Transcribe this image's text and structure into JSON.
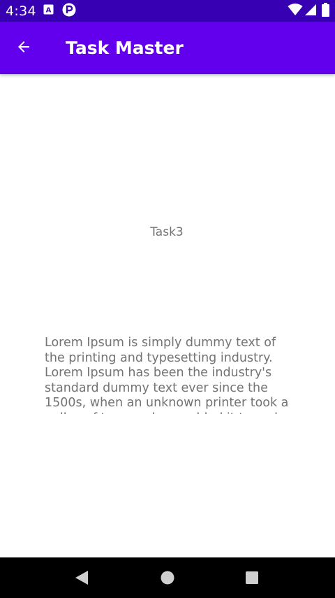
{
  "status_bar": {
    "time": "4:34",
    "background": "#3700b3",
    "icons": [
      "a-notification-icon",
      "p-notification-icon",
      "wifi-icon",
      "signal-icon",
      "battery-icon"
    ]
  },
  "app_bar": {
    "title": "Task Master",
    "background": "#6200ee",
    "back_icon": "arrow-left-icon"
  },
  "task": {
    "title": "Task3",
    "body": "Lorem Ipsum is simply dummy text of the printing and typesetting industry. Lorem Ipsum has been the industry's standard dummy text ever since the 1500s, when an unknown printer took a galley of type and scrambled it to make a type specimen book."
  },
  "nav_bar": {
    "icons": [
      "back-triangle-icon",
      "home-circle-icon",
      "recents-square-icon"
    ]
  }
}
